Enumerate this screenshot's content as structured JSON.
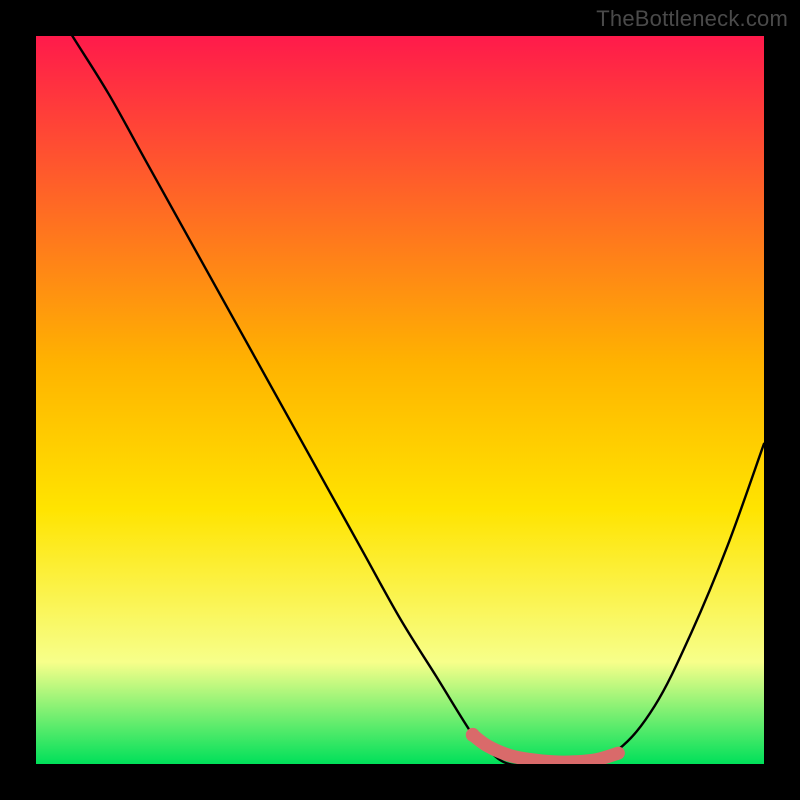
{
  "watermark": "TheBottleneck.com",
  "colors": {
    "frame": "#000000",
    "grad_top": "#ff1a4b",
    "grad_mid1": "#ffb300",
    "grad_mid2": "#ffe400",
    "grad_low": "#f7ff8a",
    "grad_bottom": "#00e05a",
    "curve": "#000000",
    "marker_fill": "#d96a6a",
    "marker_stroke": "#c95858"
  },
  "chart_data": {
    "type": "line",
    "title": "",
    "xlabel": "",
    "ylabel": "",
    "xlim": [
      0,
      100
    ],
    "ylim": [
      0,
      100
    ],
    "series": [
      {
        "name": "bottleneck-curve",
        "x": [
          0,
          5,
          10,
          15,
          20,
          25,
          30,
          35,
          40,
          45,
          50,
          55,
          60,
          62,
          65,
          70,
          75,
          80,
          85,
          90,
          95,
          100
        ],
        "values": [
          108,
          100,
          92,
          83,
          74,
          65,
          56,
          47,
          38,
          29,
          20,
          12,
          4,
          2,
          0,
          0,
          0,
          2,
          8,
          18,
          30,
          44
        ]
      }
    ],
    "optimal_range": {
      "name": "optimal-marker",
      "x": [
        60,
        62,
        65,
        68,
        71,
        74,
        77,
        80
      ],
      "values": [
        4,
        2.5,
        1.2,
        0.6,
        0.3,
        0.3,
        0.6,
        1.5
      ]
    },
    "annotations": []
  }
}
